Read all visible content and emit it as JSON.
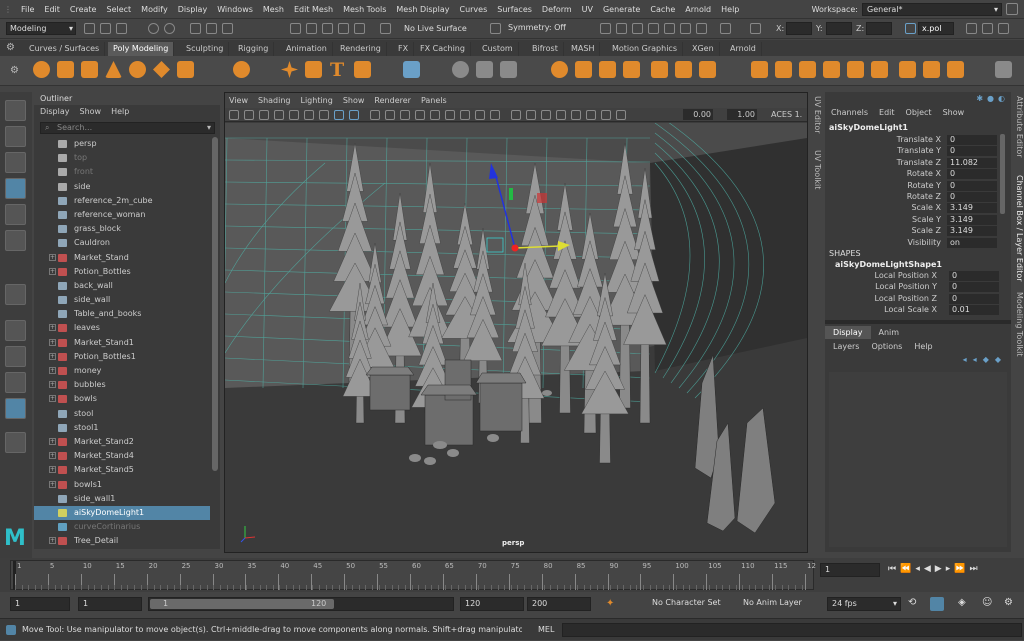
{
  "menubar": {
    "items": [
      "File",
      "Edit",
      "Create",
      "Select",
      "Modify",
      "Display",
      "Windows",
      "Mesh",
      "Edit Mesh",
      "Mesh Tools",
      "Mesh Display",
      "Curves",
      "Surfaces",
      "Deform",
      "UV",
      "Generate",
      "Cache",
      "Arnold",
      "Help"
    ],
    "workspace_label": "Workspace:",
    "workspace_value": "General*"
  },
  "statusline": {
    "mode": "Modeling",
    "live_surface": "No Live Surface",
    "symmetry": "Symmetry: Off",
    "x_label": "X:",
    "y_label": "Y:",
    "z_label": "Z:",
    "search": "x.pol"
  },
  "shelf_tabs": [
    "Curves / Surfaces",
    "Poly Modeling",
    "Sculpting",
    "Rigging",
    "Animation",
    "Rendering",
    "FX",
    "FX Caching",
    "Custom",
    "Bifrost",
    "MASH",
    "Motion Graphics",
    "XGen",
    "Arnold"
  ],
  "active_shelf_tab": "Poly Modeling",
  "outliner": {
    "title": "Outliner",
    "menu": [
      "Display",
      "Show",
      "Help"
    ],
    "search_placeholder": "Search...",
    "items": [
      {
        "name": "persp",
        "icon": "camera-icon",
        "dim": false,
        "expandable": false
      },
      {
        "name": "top",
        "icon": "camera-icon",
        "dim": true,
        "expandable": false
      },
      {
        "name": "front",
        "icon": "camera-icon",
        "dim": true,
        "expandable": false
      },
      {
        "name": "side",
        "icon": "camera-icon",
        "dim": false,
        "expandable": false
      },
      {
        "name": "reference_2m_cube",
        "icon": "mesh-icon",
        "dim": false,
        "expandable": false
      },
      {
        "name": "reference_woman",
        "icon": "mesh-icon",
        "dim": false,
        "expandable": false
      },
      {
        "name": "grass_block",
        "icon": "mesh-icon",
        "dim": false,
        "expandable": false
      },
      {
        "name": "Cauldron",
        "icon": "mesh-icon",
        "dim": false,
        "expandable": false
      },
      {
        "name": "Market_Stand",
        "icon": "group-icon",
        "dim": false,
        "expandable": true
      },
      {
        "name": "Potion_Bottles",
        "icon": "group-icon",
        "dim": false,
        "expandable": true
      },
      {
        "name": "back_wall",
        "icon": "mesh-icon",
        "dim": false,
        "expandable": false
      },
      {
        "name": "side_wall",
        "icon": "mesh-icon",
        "dim": false,
        "expandable": false
      },
      {
        "name": "Table_and_books",
        "icon": "mesh-icon",
        "dim": false,
        "expandable": false
      },
      {
        "name": "leaves",
        "icon": "group-icon",
        "dim": false,
        "expandable": true
      },
      {
        "name": "Market_Stand1",
        "icon": "group-icon",
        "dim": false,
        "expandable": true
      },
      {
        "name": "Potion_Bottles1",
        "icon": "group-icon",
        "dim": false,
        "expandable": true
      },
      {
        "name": "money",
        "icon": "group-icon",
        "dim": false,
        "expandable": true
      },
      {
        "name": "bubbles",
        "icon": "group-icon",
        "dim": false,
        "expandable": true
      },
      {
        "name": "bowls",
        "icon": "group-icon",
        "dim": false,
        "expandable": true
      },
      {
        "name": "stool",
        "icon": "mesh-icon",
        "dim": false,
        "expandable": false
      },
      {
        "name": "stool1",
        "icon": "mesh-icon",
        "dim": false,
        "expandable": false
      },
      {
        "name": "Market_Stand2",
        "icon": "group-icon",
        "dim": false,
        "expandable": true
      },
      {
        "name": "Market_Stand4",
        "icon": "group-icon",
        "dim": false,
        "expandable": true
      },
      {
        "name": "Market_Stand5",
        "icon": "group-icon",
        "dim": false,
        "expandable": true
      },
      {
        "name": "bowls1",
        "icon": "group-icon",
        "dim": false,
        "expandable": true
      },
      {
        "name": "side_wall1",
        "icon": "mesh-icon",
        "dim": false,
        "expandable": false
      },
      {
        "name": "aiSkyDomeLight1",
        "icon": "light-icon",
        "dim": false,
        "expandable": false,
        "selected": true
      },
      {
        "name": "curveCortinarius",
        "icon": "curve-icon",
        "dim": true,
        "expandable": false
      },
      {
        "name": "Tree_Detail",
        "icon": "group-icon",
        "dim": false,
        "expandable": true
      }
    ]
  },
  "viewport": {
    "menu": [
      "View",
      "Shading",
      "Lighting",
      "Show",
      "Renderer",
      "Panels"
    ],
    "exposure": "0.00",
    "gamma": "1.00",
    "color_space": "ACES 1.",
    "camera_label": "persp"
  },
  "side_tabs": {
    "uv_editor": "UV Editor",
    "uv_toolkit": "UV Toolkit",
    "attribute_editor": "Attribute Editor",
    "channel_box": "Channel Box / Layer Editor",
    "modeling_toolkit": "Modeling Toolkit"
  },
  "channel_box": {
    "menu": [
      "Channels",
      "Edit",
      "Object",
      "Show"
    ],
    "node": "aiSkyDomeLight1",
    "channels": [
      {
        "label": "Translate X",
        "value": "0"
      },
      {
        "label": "Translate Y",
        "value": "0"
      },
      {
        "label": "Translate Z",
        "value": "11.082"
      },
      {
        "label": "Rotate X",
        "value": "0"
      },
      {
        "label": "Rotate Y",
        "value": "0"
      },
      {
        "label": "Rotate Z",
        "value": "0"
      },
      {
        "label": "Scale X",
        "value": "3.149"
      },
      {
        "label": "Scale Y",
        "value": "3.149"
      },
      {
        "label": "Scale Z",
        "value": "3.149"
      },
      {
        "label": "Visibility",
        "value": "on"
      }
    ],
    "shapes_header": "SHAPES",
    "shape_node": "aiSkyDomeLightShape1",
    "shape_channels": [
      {
        "label": "Local Position X",
        "value": "0"
      },
      {
        "label": "Local Position Y",
        "value": "0"
      },
      {
        "label": "Local Position Z",
        "value": "0"
      },
      {
        "label": "Local Scale X",
        "value": "0.01"
      }
    ]
  },
  "layer_editor": {
    "tabs": [
      "Display",
      "Anim"
    ],
    "menu": [
      "Layers",
      "Options",
      "Help"
    ]
  },
  "timeline": {
    "ticks": [
      "1",
      "5",
      "10",
      "15",
      "20",
      "25",
      "30",
      "35",
      "40",
      "45",
      "50",
      "55",
      "60",
      "65",
      "70",
      "75",
      "80",
      "85",
      "90",
      "95",
      "100",
      "105",
      "110",
      "115",
      "12"
    ],
    "current_frame": "1"
  },
  "range": {
    "start": "1",
    "playback_start": "1",
    "slider_start": "1",
    "slider_end": "120",
    "playback_end": "120",
    "end": "200",
    "character_set": "No Character Set",
    "anim_layer": "No Anim Layer",
    "fps": "24 fps"
  },
  "help_line": {
    "text": "Move Tool: Use manipulator to move object(s). Ctrl+middle-drag to move components along normals. Shift+drag manipulator axis or plane ha",
    "mel_label": "MEL"
  },
  "colors": {
    "accent_selection": "#5285a6",
    "shelf_icon": "#e08a2c",
    "grid": "#4fb3a8"
  }
}
